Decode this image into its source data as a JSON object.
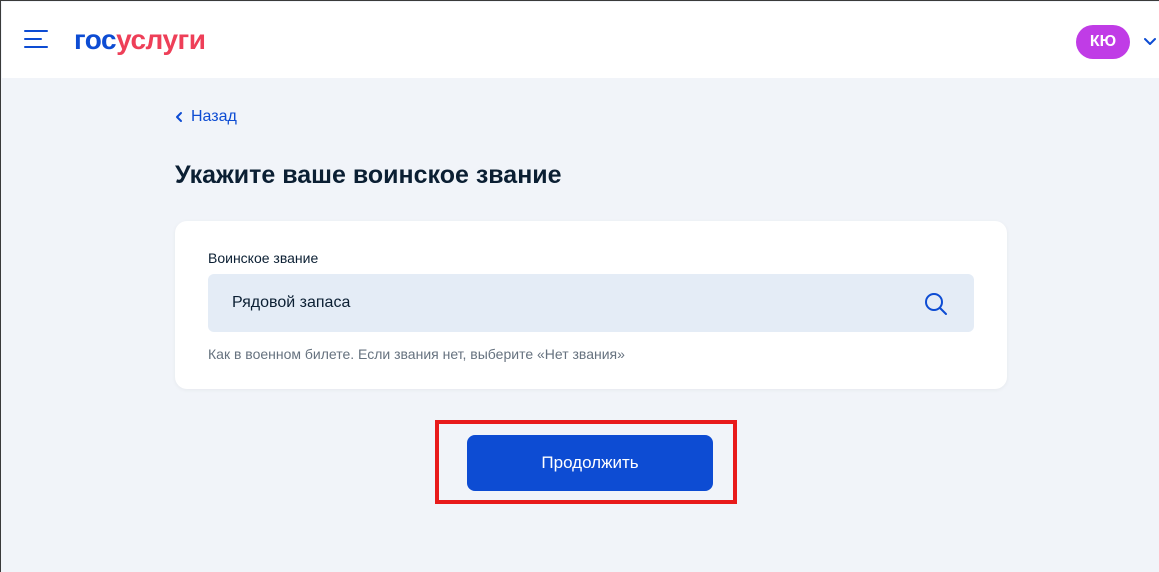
{
  "header": {
    "menu_icon": "hamburger-icon",
    "logo": {
      "part1": "гос",
      "part2": "услуги"
    },
    "user": {
      "initials": "КЮ",
      "chevron_icon": "chevron-down-icon"
    }
  },
  "nav": {
    "back_label": "Назад",
    "back_icon": "chevron-left-icon"
  },
  "page": {
    "title": "Укажите ваше воинское звание"
  },
  "form": {
    "field_label": "Воинское звание",
    "field_value": "Рядовой запаса",
    "field_icon": "search-icon",
    "hint": "Как в военном билете. Если звания нет, выберите «Нет звания»"
  },
  "actions": {
    "continue_label": "Продолжить"
  },
  "colors": {
    "brand_blue": "#0d4cd3",
    "brand_red": "#ee3f58",
    "avatar": "#c03ce6",
    "page_bg": "#f1f4f9",
    "highlight": "#e81b1b"
  }
}
